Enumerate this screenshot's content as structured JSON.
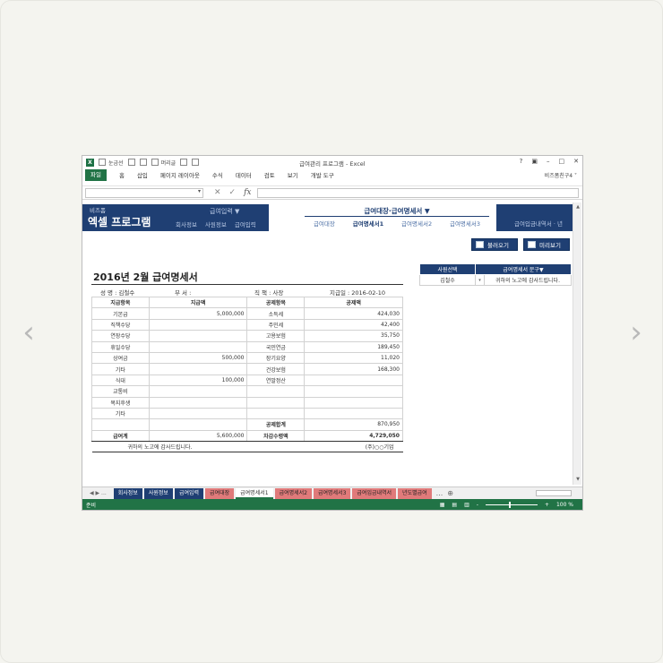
{
  "carousel": {
    "prev": "‹",
    "next": "›"
  },
  "window": {
    "title": "급여관리 프로그램 - Excel",
    "qat_gridlines": "눈금선",
    "qat_header": "머리글",
    "controls": [
      "?",
      "▣",
      "–",
      "□",
      "✕"
    ],
    "user": "비즈폼친구4 ˅"
  },
  "ribbon": {
    "file": "파일",
    "tabs": [
      "홈",
      "삽입",
      "페이지 레이아웃",
      "수식",
      "데이터",
      "검토",
      "보기",
      "개발 도구"
    ]
  },
  "formula_bar": {
    "name_box": "",
    "fx": "fx",
    "value": ""
  },
  "header": {
    "brand_small": "비즈폼",
    "brand_big": "엑셀 프로그램",
    "menu_input": "급여입력 ▼",
    "links": [
      "회사정보",
      "사원정보",
      "급여입력"
    ],
    "center_title": "급여대장·급여명세서 ▼",
    "center_items": [
      "급여대장",
      "급여명세서1",
      "급여명세서2",
      "급여명세서3"
    ],
    "right_menu": "급여입금내역서 · 년"
  },
  "buttons": {
    "load": "불러오기",
    "preview": "미리보기"
  },
  "payslip": {
    "title": "2016년 2월 급여명세서",
    "name": "성 명 : 김철수",
    "dept": "부 서 :",
    "position": "직 책 : 사장",
    "paydate": "지급일 : 2016-02-10",
    "headers": [
      "지급항목",
      "지급액",
      "공제항목",
      "공제액"
    ],
    "rows": [
      [
        "기본급",
        "5,000,000",
        "소득세",
        "424,030"
      ],
      [
        "직책수당",
        "",
        "주민세",
        "42,400"
      ],
      [
        "연장수당",
        "",
        "고용보험",
        "35,750"
      ],
      [
        "휴일수당",
        "",
        "국민연금",
        "189,450"
      ],
      [
        "상여금",
        "500,000",
        "장기요양",
        "11,020"
      ],
      [
        "기타",
        "",
        "건강보험",
        "168,300"
      ],
      [
        "식대",
        "100,000",
        "연말정산",
        ""
      ],
      [
        "교통비",
        "",
        "",
        ""
      ],
      [
        "복지후생",
        "",
        "",
        ""
      ],
      [
        "기타",
        "",
        "",
        ""
      ]
    ],
    "deduct_total_label": "공제합계",
    "deduct_total": "870,950",
    "pay_total_label": "급여계",
    "pay_total": "5,600,000",
    "net_label": "차감수령액",
    "net": "4,729,050",
    "thanks": "귀하의 노고에 감사드립니다.",
    "company": "(주)○○기업"
  },
  "side": {
    "col1": "사원선택",
    "col2": "급여명세서 문구▼",
    "employee": "김철수",
    "dropdown": "▾",
    "phrase": "귀하의 노고에 감사드립니다."
  },
  "sheet_tabs": {
    "nav": "◀ ▶ ...",
    "tabs": [
      {
        "label": "회사정보",
        "style": "navy"
      },
      {
        "label": "사원정보",
        "style": "navy"
      },
      {
        "label": "급여입력",
        "style": "navy"
      },
      {
        "label": "급여대장",
        "style": "pink"
      },
      {
        "label": "급여명세서1",
        "style": "white"
      },
      {
        "label": "급여명세서2",
        "style": "pink"
      },
      {
        "label": "급여명세서3",
        "style": "pink"
      },
      {
        "label": "급여입금내역서",
        "style": "pink"
      },
      {
        "label": "년도별급여",
        "style": "pink"
      }
    ],
    "more": "...",
    "add": "⊕"
  },
  "status": {
    "ready": "준비",
    "zoom": "100 %"
  }
}
